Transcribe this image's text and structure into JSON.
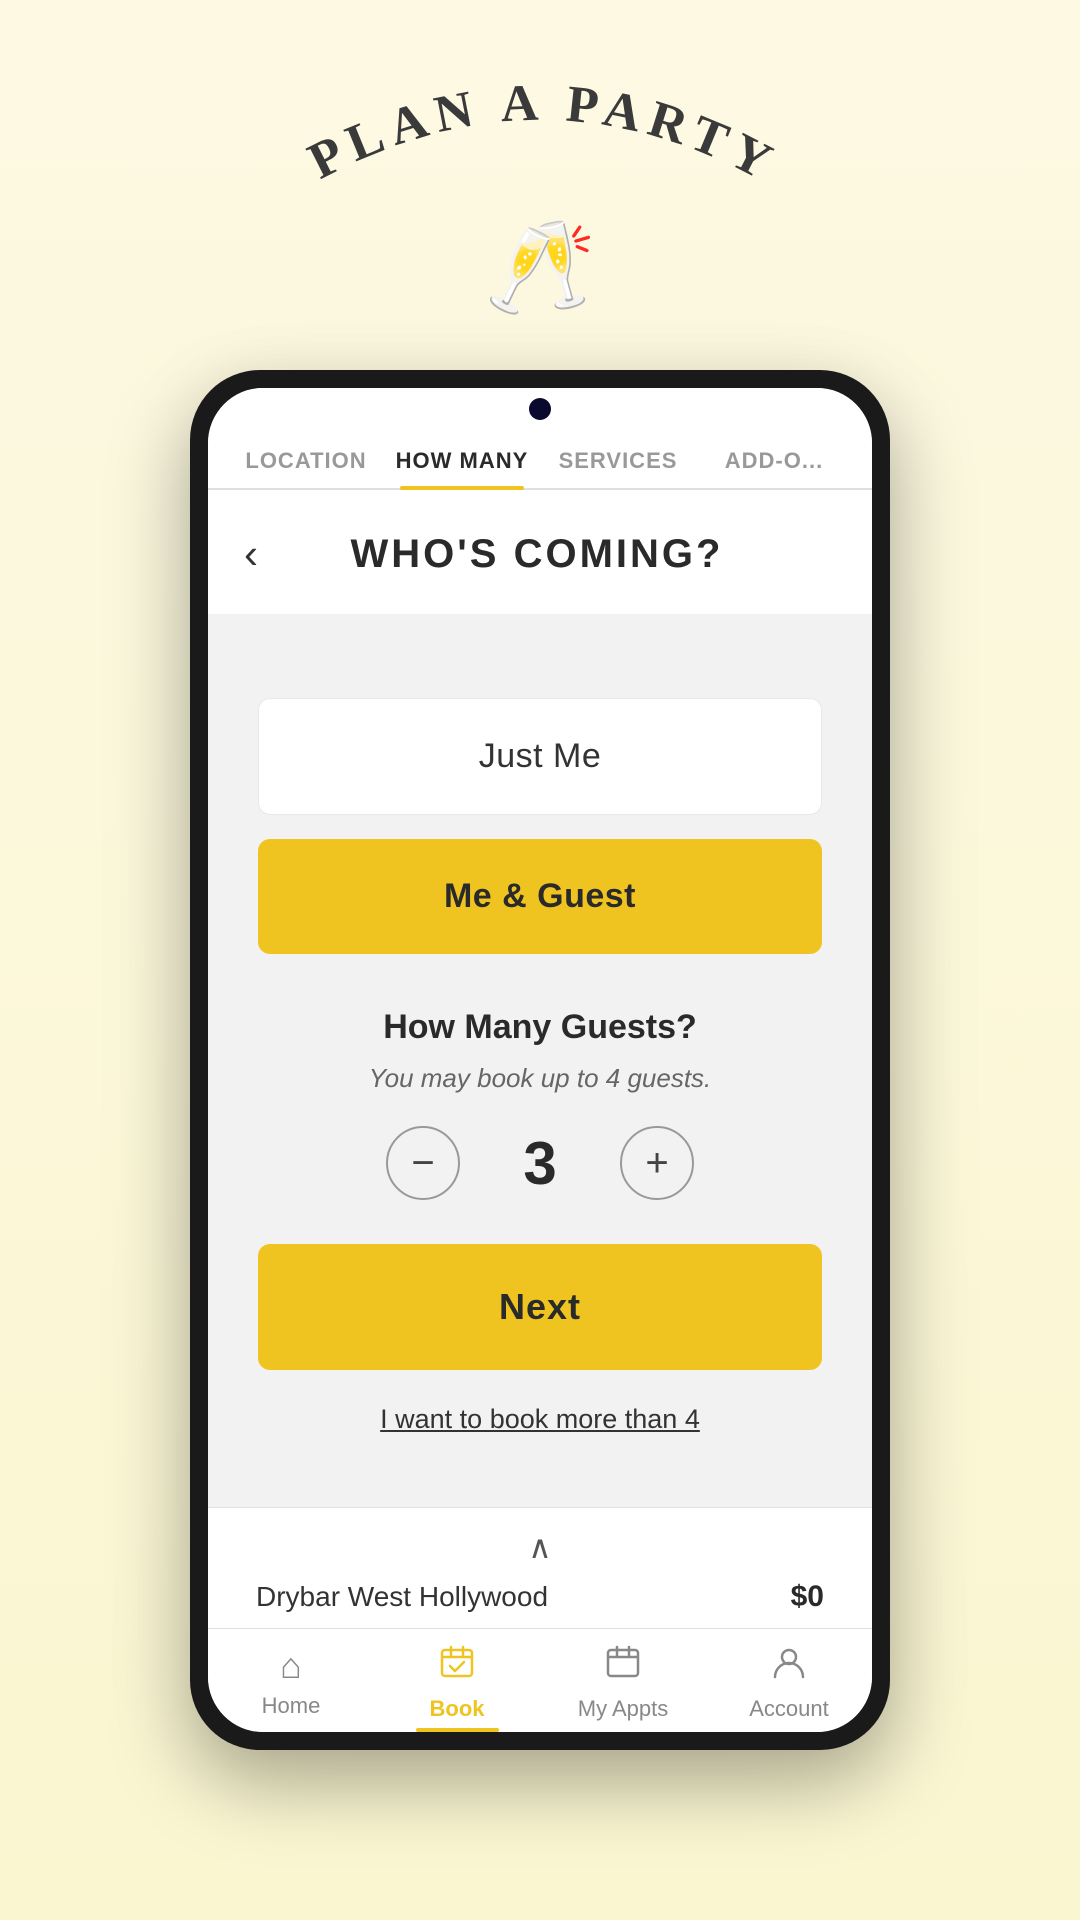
{
  "header": {
    "title": "PLAN A PARTY",
    "icon": "🥂"
  },
  "tabs": [
    {
      "id": "location",
      "label": "LOCATION",
      "active": false
    },
    {
      "id": "how-many",
      "label": "HOW MANY",
      "active": true
    },
    {
      "id": "services",
      "label": "SERVICES",
      "active": false
    },
    {
      "id": "add-ons",
      "label": "ADD-O...",
      "active": false
    }
  ],
  "page": {
    "title": "WHO'S COMING?",
    "back_label": "‹"
  },
  "options": [
    {
      "id": "just-me",
      "label": "Just Me",
      "active": false
    },
    {
      "id": "me-and-guest",
      "label": "Me & Guest",
      "active": true
    }
  ],
  "guests": {
    "title": "How Many Guests?",
    "subtitle": "You may book up to 4 guests.",
    "count": "3",
    "minus_label": "−",
    "plus_label": "+"
  },
  "next_button": {
    "label": "Next"
  },
  "more_link": {
    "label": "I want to book more than 4"
  },
  "bottom_bar": {
    "chevron": "∧",
    "location": "Drybar West Hollywood",
    "price": "$0"
  },
  "nav": [
    {
      "id": "home",
      "label": "Home",
      "icon": "⌂",
      "active": false
    },
    {
      "id": "book",
      "label": "Book",
      "icon": "📅",
      "active": true
    },
    {
      "id": "my-appts",
      "label": "My Appts",
      "icon": "🗓",
      "active": false
    },
    {
      "id": "account",
      "label": "Account",
      "icon": "👤",
      "active": false
    }
  ]
}
